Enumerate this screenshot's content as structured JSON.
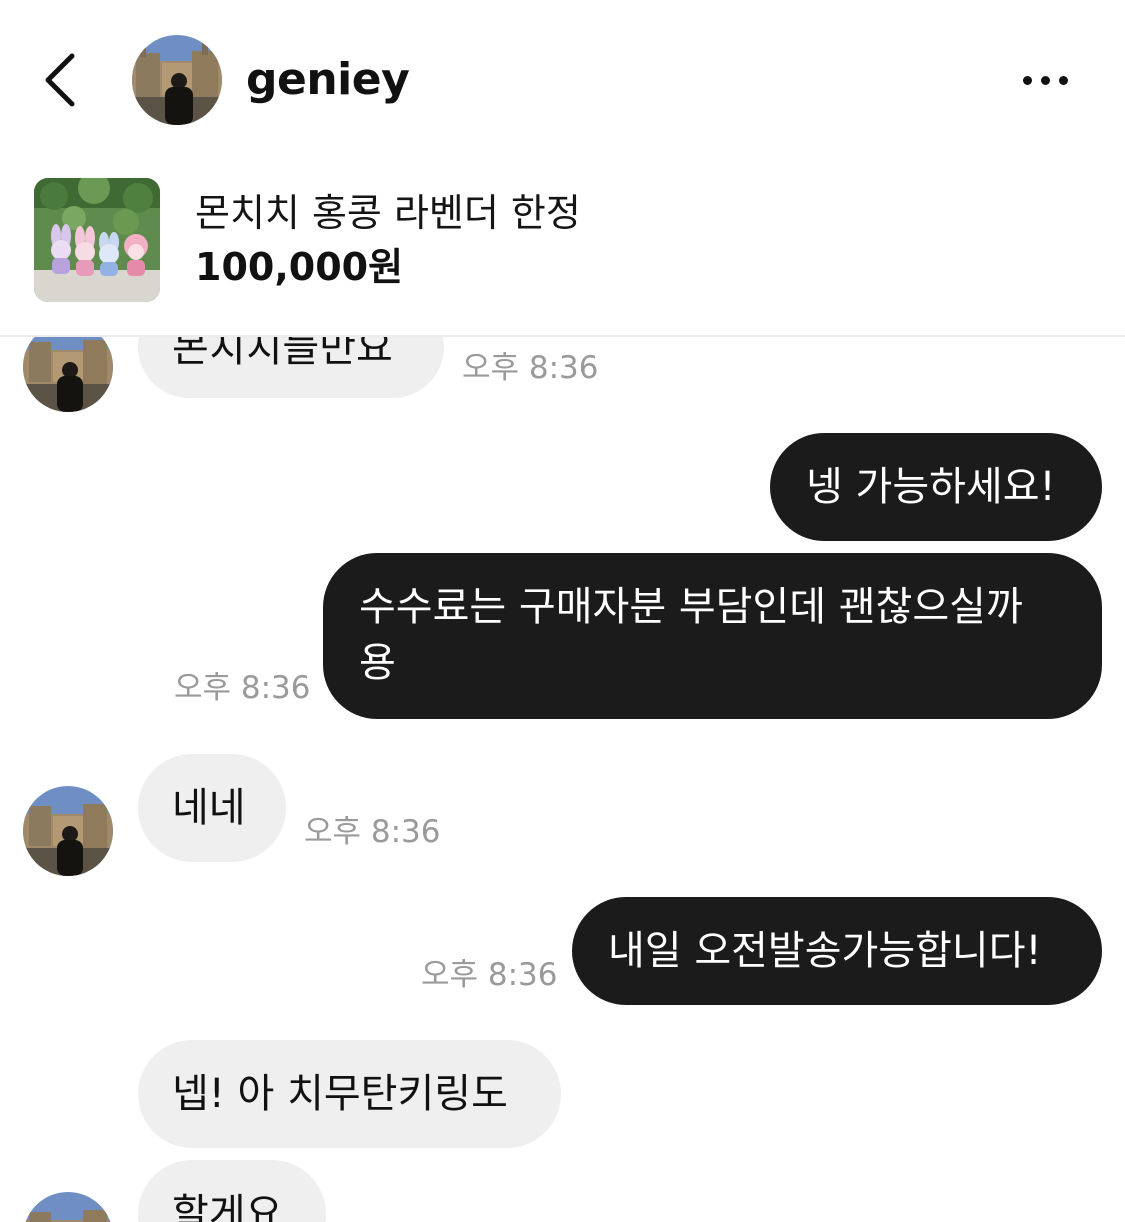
{
  "header": {
    "username": "geniey",
    "back_icon": "chevron-left-icon",
    "more_icon": "more-horizontal-icon"
  },
  "product": {
    "title": "몬치치 홍콩 라벤더 한정",
    "price": "100,000원"
  },
  "messages": [
    {
      "from": "them",
      "text": "몬치치들만요",
      "time": "오후 8:36"
    },
    {
      "from": "me",
      "text": "넹 가능하세요!",
      "time": ""
    },
    {
      "from": "me",
      "text_line1": "수수료는 구매자분 부담인데 괜찮으실까",
      "text_line2": "용",
      "time": "오후 8:36"
    },
    {
      "from": "them",
      "text": "네네",
      "time": "오후 8:36"
    },
    {
      "from": "me",
      "text": "내일 오전발송가능합니다!",
      "time": "오후 8:36"
    },
    {
      "from": "them",
      "text": "넵! 아 치무탄키링도",
      "time": ""
    },
    {
      "from": "them",
      "text": "할게요",
      "time": ""
    }
  ],
  "colors": {
    "outgoing_bubble": "#1b1b1b",
    "incoming_bubble": "#efefef",
    "timestamp": "#9a9a9a"
  }
}
